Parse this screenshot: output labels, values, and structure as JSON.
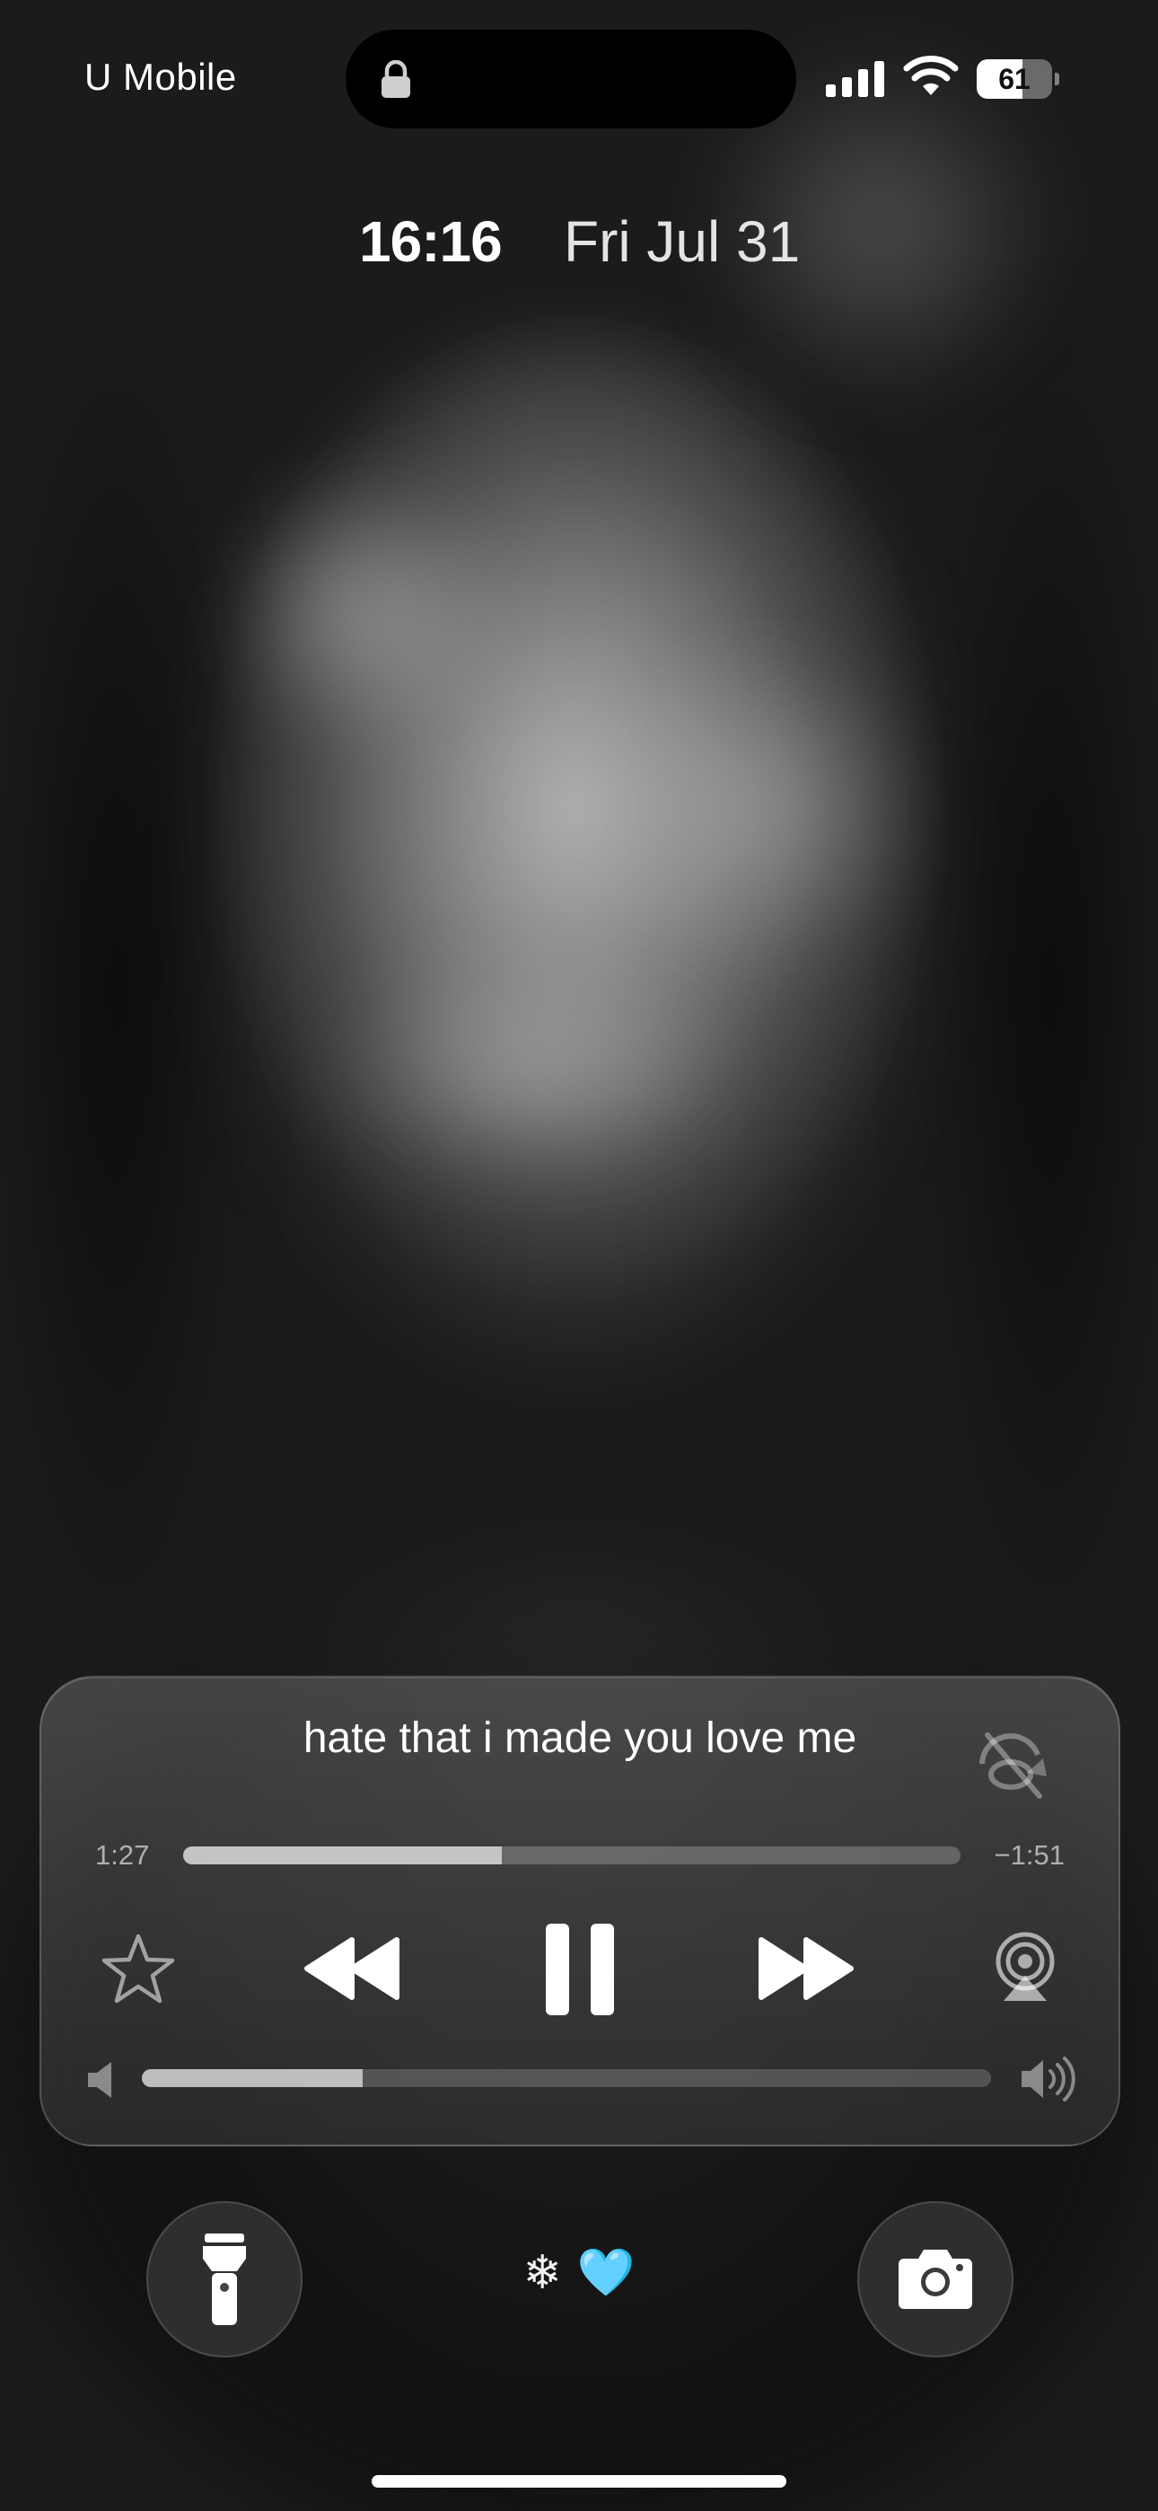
{
  "status_bar": {
    "carrier": "U Mobile",
    "battery_percent": "61",
    "battery_level": 0.61,
    "icons": [
      "lock-icon",
      "signal-icon",
      "wifi-icon",
      "battery-icon"
    ]
  },
  "lock_screen": {
    "time": "16:16",
    "date": "Fri Jul 31"
  },
  "now_playing": {
    "title": "hate that i made you love me",
    "elapsed": "1:27",
    "remaining": "−1:51",
    "progress": 0.41,
    "volume": 0.26,
    "icons": {
      "lyrics": "lyrics-off-icon",
      "favorite": "star-icon",
      "rewind": "rewind-icon",
      "pause": "pause-icon",
      "forward": "forward-icon",
      "airplay": "airplay-icon",
      "volume_low": "speaker-low-icon",
      "volume_high": "speaker-high-icon"
    }
  },
  "bottom_bar": {
    "snowflake": "❄",
    "heart": "🩵",
    "left_button_icon": "flashlight-icon",
    "right_button_icon": "camera-icon"
  },
  "colors": {
    "heart": "#55c4f5",
    "widget_bg": "#5a5a5a"
  }
}
